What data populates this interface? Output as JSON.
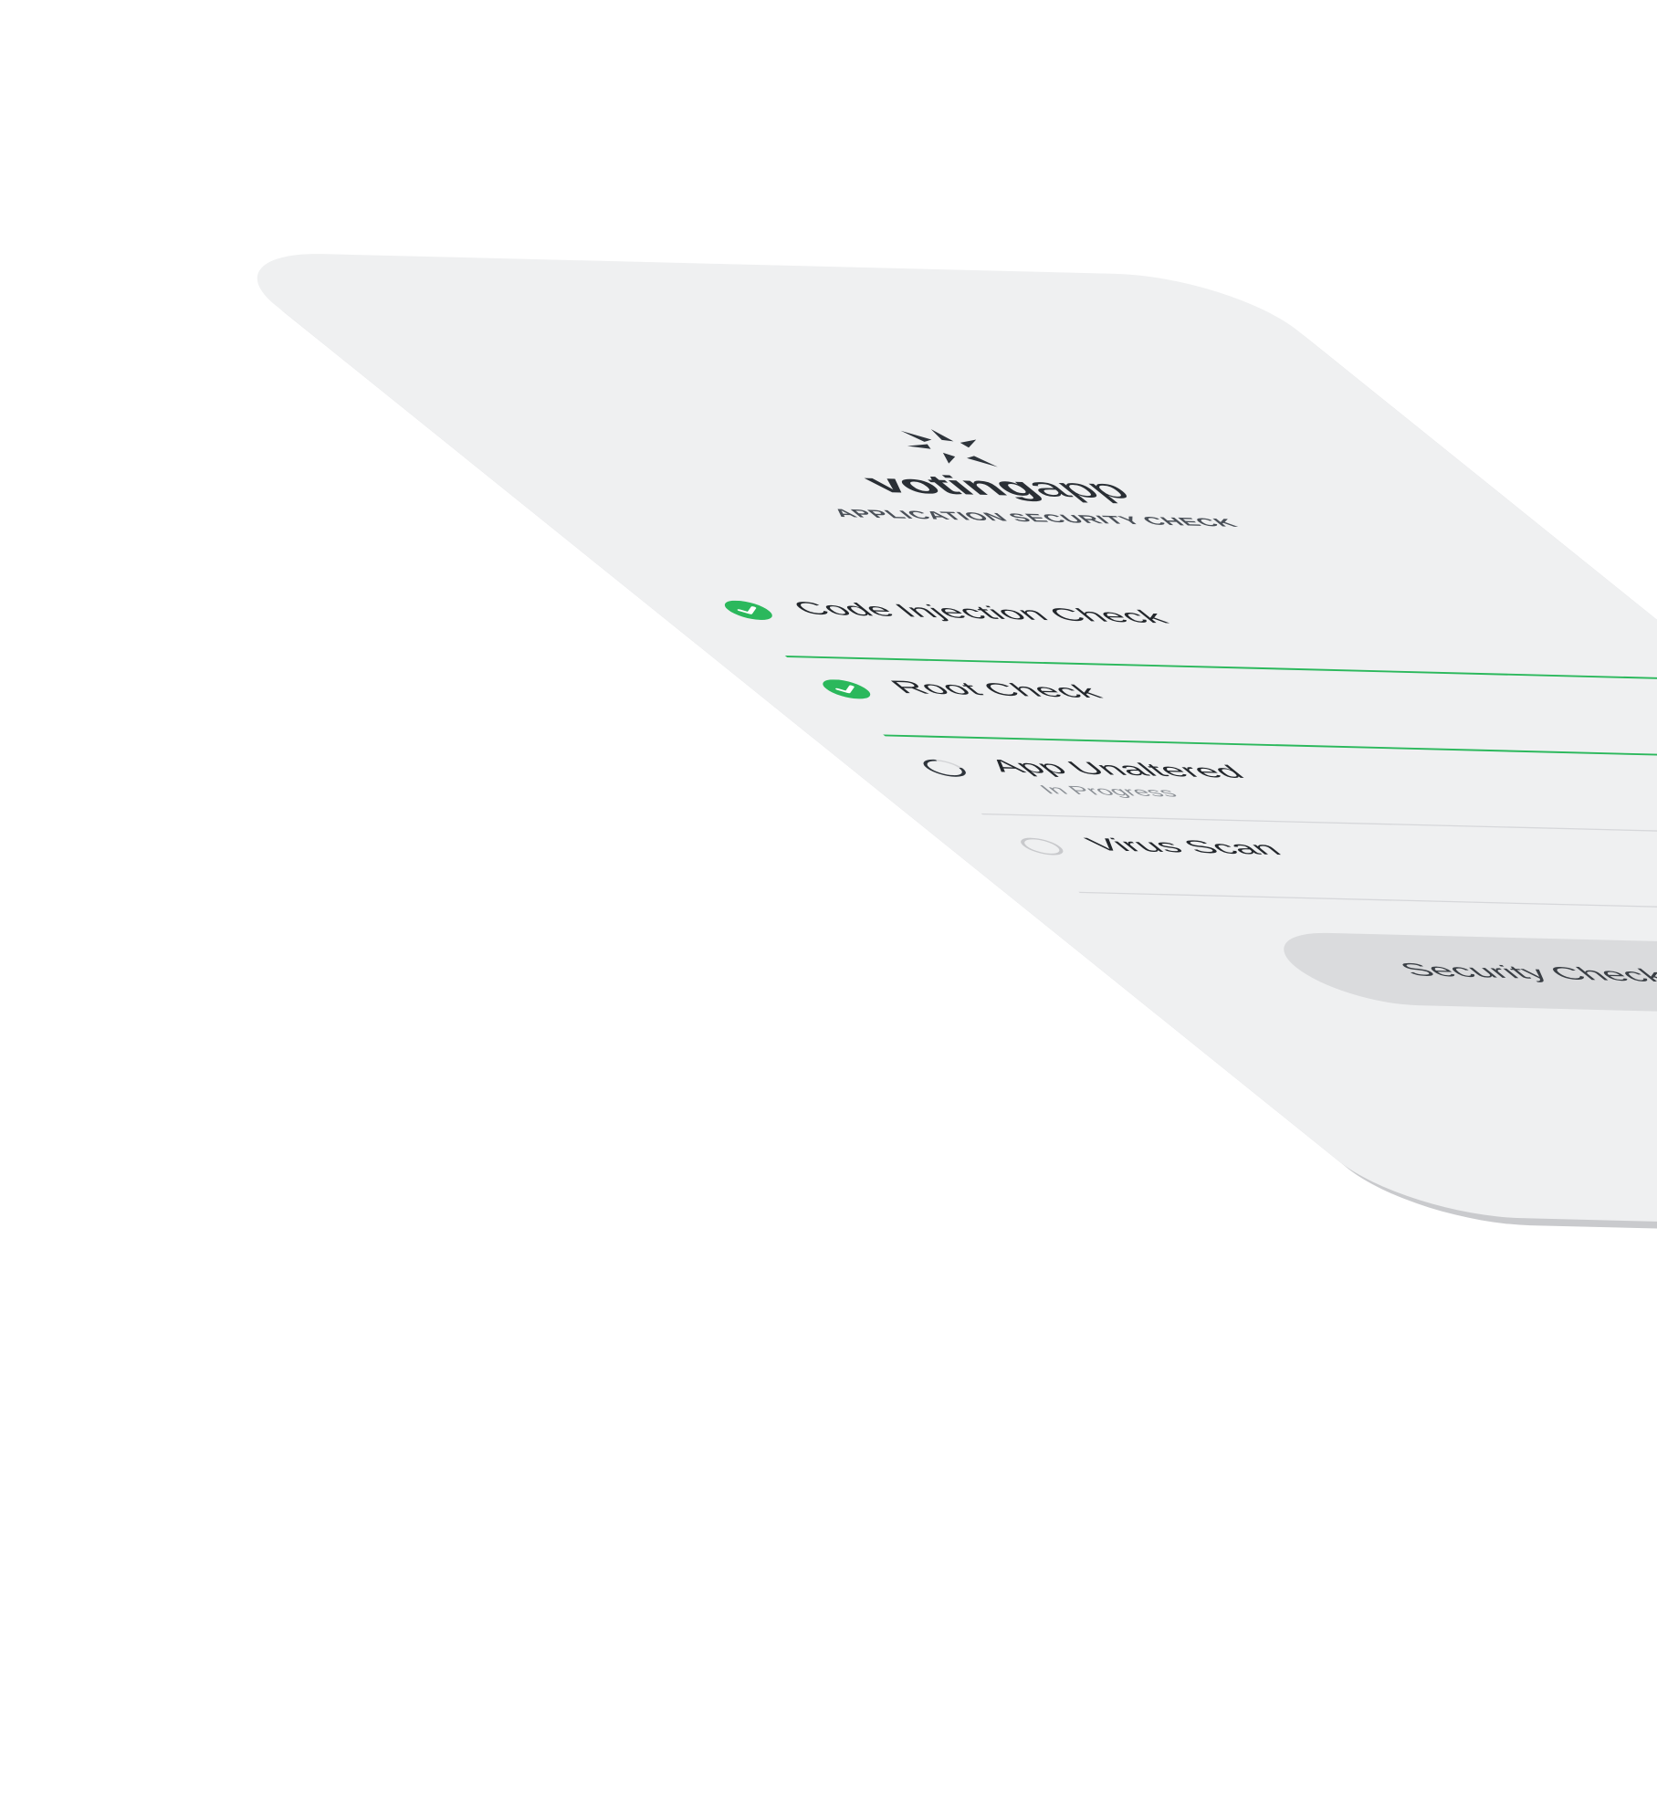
{
  "app": {
    "name_bold": "voting",
    "name_light": "app",
    "subtitle": "APPLICATION SECURITY CHECK"
  },
  "checks": [
    {
      "label": "Code Injection Check",
      "status": "complete",
      "sub": ""
    },
    {
      "label": "Root Check",
      "status": "complete",
      "sub": ""
    },
    {
      "label": "App Unaltered",
      "status": "in-progress",
      "sub": "In Progress"
    },
    {
      "label": "Virus Scan",
      "status": "pending",
      "sub": ""
    }
  ],
  "button": {
    "label": "Security Check In Progress..."
  },
  "colors": {
    "success": "#2bb85c",
    "screen_bg": "#eff0f1",
    "button_bg": "#dadbdd",
    "text": "#23272c"
  },
  "icons": {
    "logo": "star-logo-icon",
    "complete": "check-circle-icon",
    "in_progress": "spinner-icon",
    "pending": "empty-circle-icon"
  }
}
